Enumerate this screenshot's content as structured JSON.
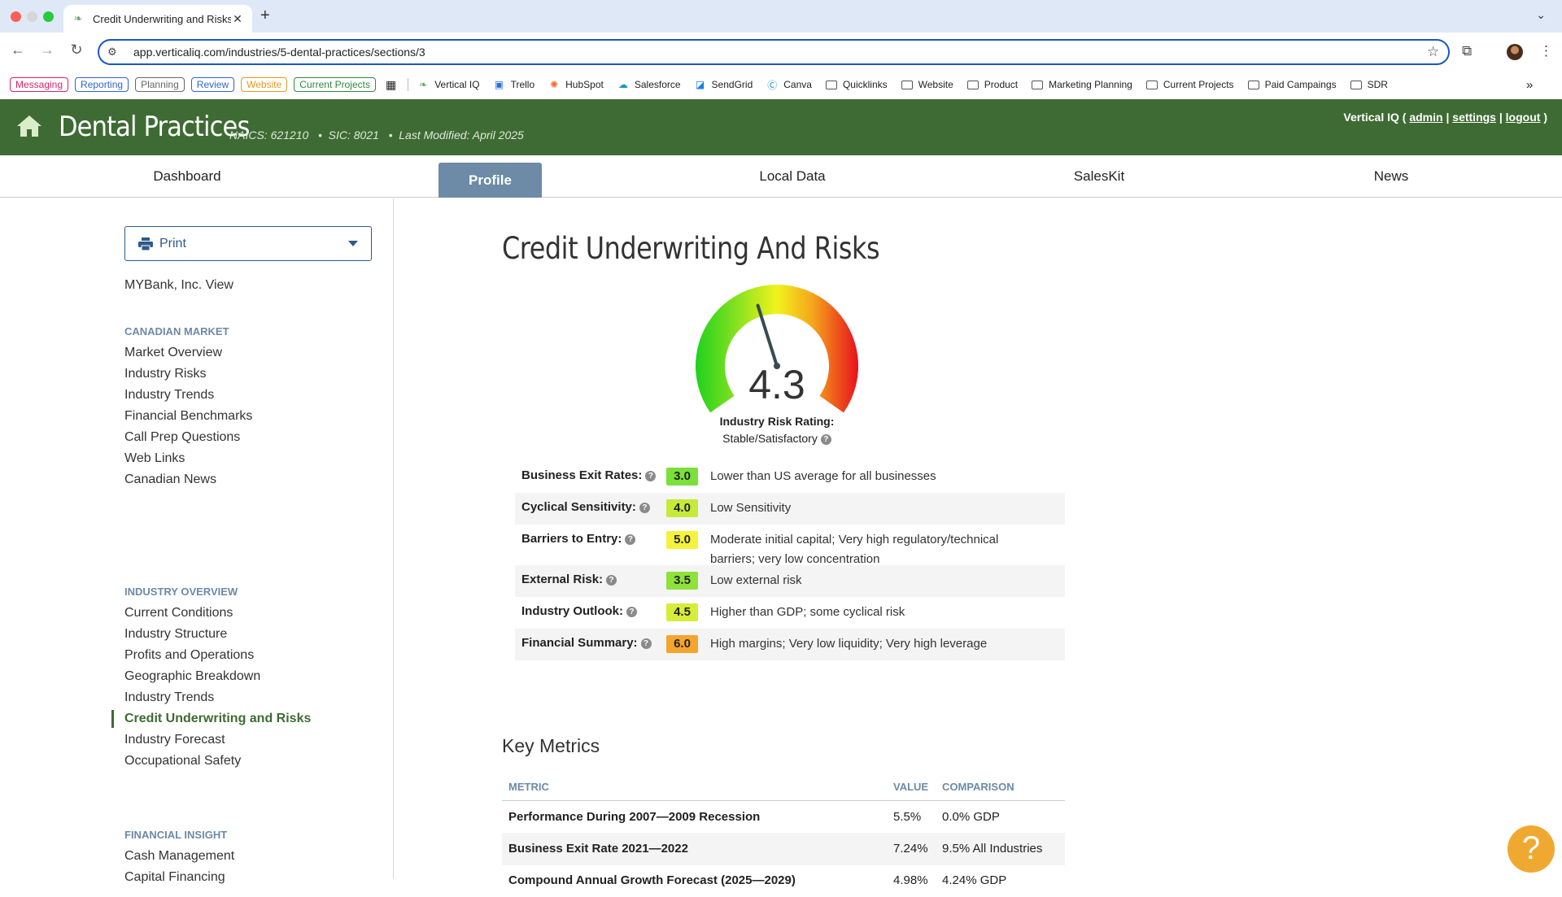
{
  "browser": {
    "tab_title": "Credit Underwriting and Risks",
    "tab_close": "✕",
    "new_tab": "+",
    "url": "app.verticaliq.com/industries/5-dental-practices/sections/3",
    "bookmark_pills": [
      {
        "label": "Messaging",
        "color": "#d6246e"
      },
      {
        "label": "Reporting",
        "color": "#2f66c8"
      },
      {
        "label": "Planning",
        "color": "#666666"
      },
      {
        "label": "Review",
        "color": "#2f66c8"
      },
      {
        "label": "Website",
        "color": "#e59a1e"
      },
      {
        "label": "Current Projects",
        "color": "#2e8b3e"
      }
    ],
    "bookmarks": [
      "Vertical IQ",
      "Trello",
      "HubSpot",
      "Salesforce",
      "SendGrid",
      "Canva",
      "Quicklinks",
      "Website",
      "Product",
      "Marketing Planning",
      "Current Projects",
      "Paid Campaings",
      "SDR"
    ],
    "more": "»"
  },
  "header": {
    "title": "Dental Practices",
    "meta": "NAICS: 621210   •  SIC: 8021   •  Last Modified: April 2025",
    "user_prefix": "Vertical IQ (",
    "admin": "admin",
    "settings": "settings",
    "logout": "logout",
    "user_suffix": ")",
    "sep": "|",
    "accent": "#3e6b33"
  },
  "nav": [
    "Dashboard",
    "Profile",
    "Local Data",
    "SalesKit",
    "News"
  ],
  "sidebar": {
    "print_label": "Print",
    "view_label": "MYBank, Inc. View",
    "sections": [
      {
        "title": "CANADIAN MARKET",
        "items": [
          "Market Overview",
          "Industry Risks",
          "Industry Trends",
          "Financial Benchmarks",
          "Call Prep Questions",
          "Web Links",
          "Canadian News"
        ]
      },
      {
        "title": "INDUSTRY OVERVIEW",
        "items": [
          "Current Conditions",
          "Industry Structure",
          "Profits and Operations",
          "Geographic Breakdown",
          "Industry Trends",
          "Credit Underwriting and Risks",
          "Industry Forecast",
          "Occupational Safety"
        ]
      },
      {
        "title": "FINANCIAL INSIGHT",
        "items": [
          "Cash Management",
          "Capital Financing"
        ]
      }
    ]
  },
  "main": {
    "title": "Credit Underwriting And Risks",
    "gauge": {
      "value": "4.3",
      "label": "Industry Risk Rating:",
      "status": "Stable/Satisfactory",
      "scale_max": 10
    },
    "risks": [
      {
        "label": "Business Exit Rates:",
        "score": "3.0",
        "color": "#7be03a",
        "desc": "Lower than US average for all businesses"
      },
      {
        "label": "Cyclical Sensitivity:",
        "score": "4.0",
        "color": "#c5ea3a",
        "desc": "Low Sensitivity"
      },
      {
        "label": "Barriers to Entry:",
        "score": "5.0",
        "color": "#f5f23c",
        "desc": "Moderate initial capital; Very high regulatory/technical barriers; very low concentration"
      },
      {
        "label": "External Risk:",
        "score": "3.5",
        "color": "#8fe23a",
        "desc": "Low external risk"
      },
      {
        "label": "Industry Outlook:",
        "score": "4.5",
        "color": "#d8ec3a",
        "desc": "Higher than GDP; some cyclical risk"
      },
      {
        "label": "Financial Summary:",
        "score": "6.0",
        "color": "#f4a52e",
        "desc": "High margins; Very low liquidity; Very high leverage"
      }
    ],
    "key_metrics": {
      "title": "Key Metrics",
      "headers": [
        "METRIC",
        "VALUE",
        "COMPARISON"
      ],
      "rows": [
        {
          "metric": "Performance During 2007—2009 Recession",
          "value": "5.5%",
          "comparison": "0.0% GDP"
        },
        {
          "metric": "Business Exit Rate 2021—2022",
          "value": "7.24%",
          "comparison": "9.5% All Industries"
        },
        {
          "metric": "Compound Annual Growth Forecast (2025—2029)",
          "value": "4.98%",
          "comparison": "4.24% GDP"
        }
      ]
    }
  },
  "help": {
    "label": "?"
  }
}
